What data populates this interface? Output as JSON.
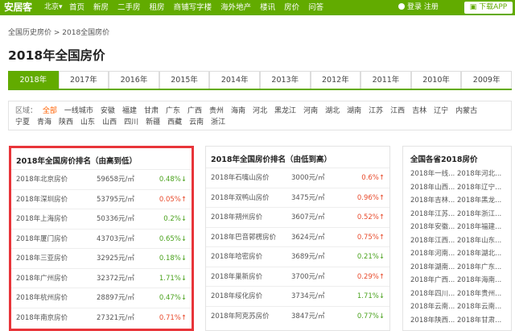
{
  "header": {
    "logo": "安居客",
    "city": "北京▾",
    "nav": [
      "首页",
      "新房",
      "二手房",
      "租房",
      "商铺写字楼",
      "海外地产",
      "楼讯",
      "房价",
      "问答"
    ],
    "login": "登录 注册",
    "app_button": "下载APP",
    "brand_color": "#62ab00"
  },
  "breadcrumb": "全国历史房价 > 2018全国房价",
  "page_title": "2018年全国房价",
  "years": [
    "2018年",
    "2017年",
    "2016年",
    "2015年",
    "2014年",
    "2013年",
    "2012年",
    "2011年",
    "2010年",
    "2009年"
  ],
  "active_year": "2018年",
  "regions": {
    "label": "区域：",
    "items": [
      "全部",
      "一线城市",
      "安徽",
      "福建",
      "甘肃",
      "广东",
      "广西",
      "贵州",
      "海南",
      "河北",
      "黑龙江",
      "河南",
      "湖北",
      "湖南",
      "江苏",
      "江西",
      "吉林",
      "辽宁",
      "内蒙古",
      "宁夏",
      "青海",
      "陕西",
      "山东",
      "山西",
      "四川",
      "新疆",
      "西藏",
      "云南",
      "浙江"
    ]
  },
  "panel_high": {
    "title": "2018年全国房价排名（由高到低）",
    "rows": [
      {
        "city": "2018年北京房价",
        "price": "59658元/㎡",
        "change": "0.48%↓",
        "dir": "down"
      },
      {
        "city": "2018年深圳房价",
        "price": "53795元/㎡",
        "change": "0.05%↑",
        "dir": "up"
      },
      {
        "city": "2018年上海房价",
        "price": "50336元/㎡",
        "change": "0.2%↓",
        "dir": "down"
      },
      {
        "city": "2018年厦门房价",
        "price": "43703元/㎡",
        "change": "0.65%↓",
        "dir": "down"
      },
      {
        "city": "2018年三亚房价",
        "price": "32925元/㎡",
        "change": "0.18%↓",
        "dir": "down"
      },
      {
        "city": "2018年广州房价",
        "price": "32372元/㎡",
        "change": "1.71%↓",
        "dir": "down"
      },
      {
        "city": "2018年杭州房价",
        "price": "28897元/㎡",
        "change": "0.47%↓",
        "dir": "down"
      },
      {
        "city": "2018年南京房价",
        "price": "27321元/㎡",
        "change": "0.71%↑",
        "dir": "up"
      }
    ]
  },
  "panel_low": {
    "title": "2018年全国房价排名（由低到高）",
    "rows": [
      {
        "city": "2018年石嘴山房价",
        "price": "3000元/㎡",
        "change": "0.6%↑",
        "dir": "up"
      },
      {
        "city": "2018年双鸭山房价",
        "price": "3475元/㎡",
        "change": "0.96%↑",
        "dir": "up"
      },
      {
        "city": "2018年朔州房价",
        "price": "3607元/㎡",
        "change": "0.52%↑",
        "dir": "up"
      },
      {
        "city": "2018年巴音郭楞房价",
        "price": "3624元/㎡",
        "change": "0.75%↑",
        "dir": "up"
      },
      {
        "city": "2018年哈密房价",
        "price": "3689元/㎡",
        "change": "0.21%↓",
        "dir": "down"
      },
      {
        "city": "2018年巢新房价",
        "price": "3700元/㎡",
        "change": "0.29%↑",
        "dir": "up"
      },
      {
        "city": "2018年绥化房价",
        "price": "3734元/㎡",
        "change": "1.71%↓",
        "dir": "down"
      },
      {
        "city": "2018年阿克苏房价",
        "price": "3847元/㎡",
        "change": "0.77%↓",
        "dir": "down"
      }
    ]
  },
  "panel_provinces": {
    "title": "全国各省2018房价",
    "rows": [
      [
        "2018年一线...",
        "2018年河北..."
      ],
      [
        "2018年山西...",
        "2018年辽宁..."
      ],
      [
        "2018年吉林...",
        "2018年黑龙..."
      ],
      [
        "2018年江苏...",
        "2018年浙江..."
      ],
      [
        "2018年安徽...",
        "2018年福建..."
      ],
      [
        "2018年江西...",
        "2018年山东..."
      ],
      [
        "2018年河南...",
        "2018年湖北..."
      ],
      [
        "2018年湖南...",
        "2018年广东..."
      ],
      [
        "2018年广西...",
        "2018年海南..."
      ],
      [
        "2018年四川...",
        "2018年贵州..."
      ],
      [
        "2018年云南...",
        "2018年云南..."
      ],
      [
        "2018年陕西...",
        "2018年甘肃..."
      ]
    ]
  }
}
